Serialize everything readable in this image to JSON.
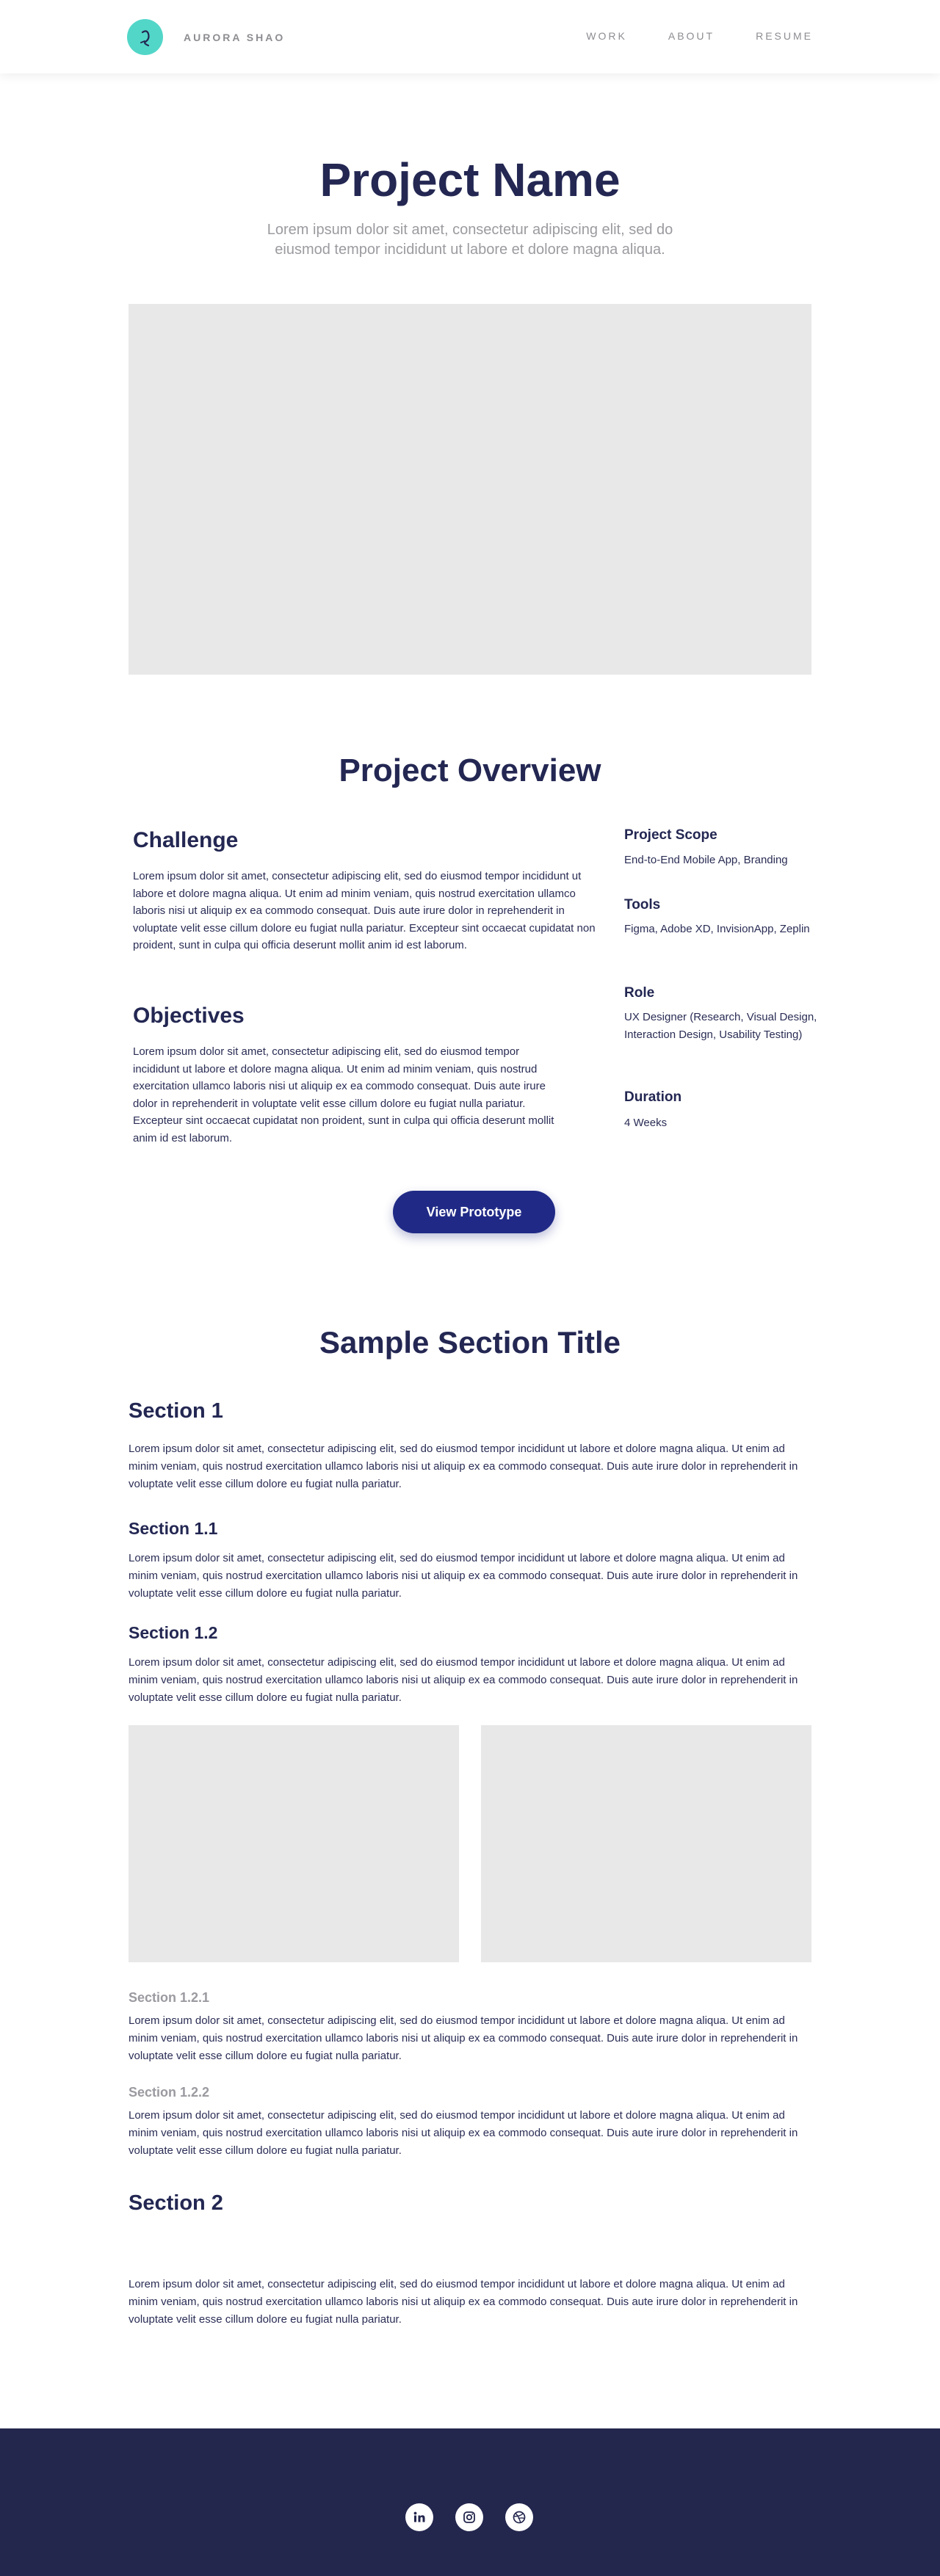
{
  "header": {
    "brand": "AURORA SHAO",
    "nav": [
      "WORK",
      "ABOUT",
      "RESUME"
    ]
  },
  "hero": {
    "title": "Project Name",
    "subtitle": "Lorem ipsum dolor sit amet, consectetur adipiscing elit, sed do eiusmod tempor incididunt ut labore et dolore magna aliqua."
  },
  "overview": {
    "title": "Project Overview",
    "challenge": {
      "heading": "Challenge",
      "body": "Lorem ipsum dolor sit amet, consectetur adipiscing elit, sed do eiusmod tempor incididunt ut labore et dolore magna aliqua. Ut enim ad minim veniam, quis nostrud exercitation ullamco laboris nisi ut aliquip ex ea commodo consequat. Duis aute irure dolor in reprehenderit in voluptate velit esse cillum dolore eu fugiat nulla pariatur. Excepteur sint occaecat cupidatat non proident, sunt in culpa qui officia deserunt mollit anim id est laborum."
    },
    "objectives": {
      "heading": "Objectives",
      "body": "Lorem ipsum dolor sit amet, consectetur adipiscing elit, sed do eiusmod tempor incididunt ut labore et dolore magna aliqua. Ut enim ad minim veniam, quis nostrud exercitation ullamco laboris nisi ut aliquip ex ea commodo consequat. Duis aute irure dolor in reprehenderit in voluptate velit esse cillum dolore eu fugiat nulla pariatur. Excepteur sint occaecat cupidatat non proident, sunt in culpa qui officia deserunt mollit anim id est laborum."
    },
    "meta": [
      {
        "label": "Project Scope",
        "value": "End-to-End Mobile App, Branding"
      },
      {
        "label": "Tools",
        "value": "Figma, Adobe XD, InvisionApp, Zeplin"
      },
      {
        "label": "Role",
        "value": "UX Designer (Research, Visual Design, Interaction Design, Usability Testing)"
      },
      {
        "label": "Duration",
        "value": "4 Weeks"
      }
    ],
    "cta": "View Prototype"
  },
  "sample": {
    "title": "Sample Section Title",
    "section1": "Section 1",
    "section1_1": "Section 1.1",
    "section1_2": "Section 1.2",
    "section1_2_1": "Section 1.2.1",
    "section1_2_2": "Section 1.2.2",
    "section2": "Section 2",
    "lorem": "Lorem ipsum dolor sit amet, consectetur adipiscing elit, sed do eiusmod tempor incididunt ut labore et dolore magna aliqua. Ut enim ad minim veniam, quis nostrud exercitation ullamco laboris nisi ut aliquip ex ea commodo consequat. Duis aute irure dolor in reprehenderit in voluptate velit esse cillum dolore eu fugiat nulla pariatur."
  },
  "footer": {
    "icons": [
      "linkedin-icon",
      "instagram-icon",
      "dribbble-icon"
    ]
  },
  "colors": {
    "accent": "#52d6c8",
    "navy": "#232752",
    "button": "#202a86",
    "placeholder": "#e8e8e8"
  }
}
